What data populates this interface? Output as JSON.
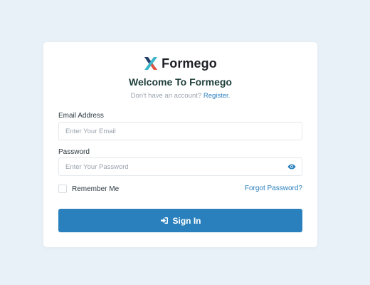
{
  "brand": {
    "name": "Formego",
    "logo_icon": "formego-x-logo",
    "logo_colors": [
      "#2a7fbd",
      "#3cb6c9",
      "#e8543c",
      "#24406b"
    ]
  },
  "header": {
    "welcome": "Welcome To Formego",
    "no_account_text": "Don't have an account?",
    "register_link": "Register."
  },
  "form": {
    "email": {
      "label": "Email Address",
      "placeholder": "Enter Your Email",
      "value": ""
    },
    "password": {
      "label": "Password",
      "placeholder": "Enter Your Password",
      "value": "",
      "toggle_icon": "eye-icon"
    },
    "remember_me": {
      "label": "Remember Me",
      "checked": false
    },
    "forgot_password": "Forgot Password?",
    "submit": {
      "label": "Sign In",
      "icon": "sign-in-icon"
    }
  },
  "colors": {
    "background": "#e9f1f8",
    "card": "#ffffff",
    "accent": "#2a80bd",
    "link": "#2a7fbd",
    "heading": "#1e3e3a"
  }
}
